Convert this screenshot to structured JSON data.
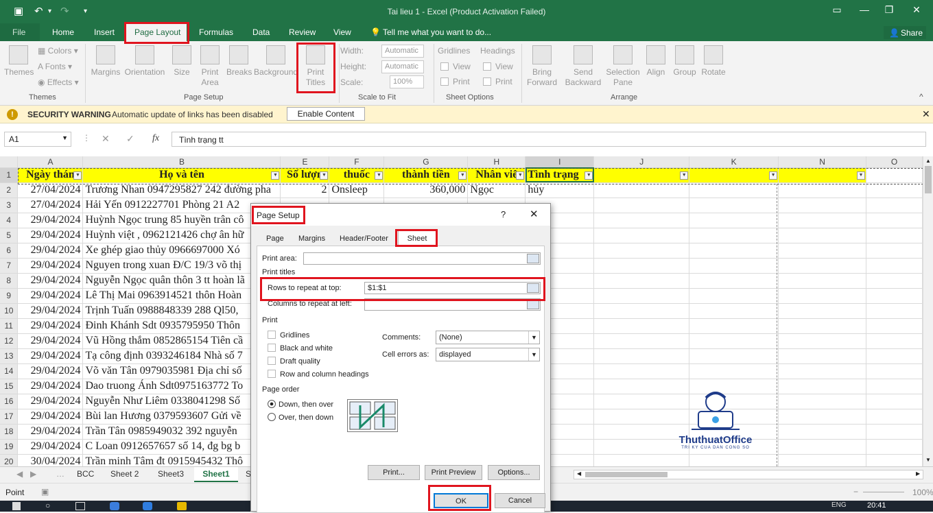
{
  "app": {
    "title": "Tai lieu 1 - Excel (Product Activation Failed)"
  },
  "tabs": [
    "File",
    "Home",
    "Insert",
    "Page Layout",
    "Formulas",
    "Data",
    "Review",
    "View"
  ],
  "tell_me": "Tell me what you want to do...",
  "share": "Share",
  "ribbon": {
    "themes": "Themes",
    "colors": "Colors",
    "fonts": "Fonts",
    "effects": "Effects",
    "margins": "Margins",
    "orientation": "Orientation",
    "size": "Size",
    "print_area": "Print Area",
    "breaks": "Breaks",
    "background": "Background",
    "print_titles": "Print Titles",
    "width": "Width:",
    "height": "Height:",
    "scale": "Scale:",
    "automatic": "Automatic",
    "scale_val": "100%",
    "gridlines": "Gridlines",
    "headings": "Headings",
    "view": "View",
    "print": "Print",
    "bring_forward": "Bring Forward",
    "send_backward": "Send Backward",
    "selection_pane": "Selection Pane",
    "align": "Align",
    "group": "Group",
    "rotate": "Rotate",
    "groups": {
      "themes": "Themes",
      "page_setup": "Page Setup",
      "scale_to_fit": "Scale to Fit",
      "sheet_options": "Sheet Options",
      "arrange": "Arrange"
    }
  },
  "security": {
    "title": "SECURITY WARNING",
    "message": "Automatic update of links has been disabled",
    "button": "Enable Content"
  },
  "formula_bar": {
    "name_box": "A1",
    "formula": "Tình trạng tt",
    "fx": "fx"
  },
  "grid": {
    "columns": [
      "A",
      "B",
      "E",
      "F",
      "G",
      "H",
      "I",
      "J",
      "K",
      "N",
      "O"
    ],
    "header_row": [
      "Ngày thán",
      "Họ và tên",
      "Số lượn",
      "thuốc",
      "thành tiền",
      "Nhân viê",
      "Tình trạng",
      "",
      "",
      "",
      ""
    ],
    "rows": [
      {
        "n": "2",
        "a": "27/04/2024",
        "b": "Trương Nhan 0947295827 242 đường pha",
        "e": "2",
        "f": "Onsleep",
        "g": "360,000",
        "h": "Ngọc",
        "i": "hủy"
      },
      {
        "n": "3",
        "a": "27/04/2024",
        "b": "Hải Yến 0912227701 Phòng 21 A2",
        "e": "",
        "f": "",
        "g": "",
        "h": "",
        "i": ""
      },
      {
        "n": "4",
        "a": "29/04/2024",
        "b": "Huỳnh Ngọc trung 85 huyền trân cô",
        "e": "",
        "f": "",
        "g": "",
        "h": "",
        "i": ""
      },
      {
        "n": "5",
        "a": "29/04/2024",
        "b": "Huỳnh việt , 0962121426 chợ ân hữ",
        "e": "",
        "f": "",
        "g": "",
        "h": "",
        "i": ""
      },
      {
        "n": "6",
        "a": "29/04/2024",
        "b": "Xe ghép giao thủy 0966697000 Xó",
        "e": "",
        "f": "",
        "g": "",
        "h": "",
        "i": ""
      },
      {
        "n": "7",
        "a": "29/04/2024",
        "b": "Nguyen trong xuan Đ/C 19/3 võ thị",
        "e": "",
        "f": "",
        "g": "",
        "h": "",
        "i": ""
      },
      {
        "n": "8",
        "a": "29/04/2024",
        "b": "Nguyễn Ngọc quân thôn 3 tt hoàn lã",
        "e": "",
        "f": "",
        "g": "",
        "h": "",
        "i": ""
      },
      {
        "n": "9",
        "a": "29/04/2024",
        "b": "Lê Thị Mai 0963914521 thôn Hoàn",
        "e": "",
        "f": "",
        "g": "",
        "h": "",
        "i": ""
      },
      {
        "n": "10",
        "a": "29/04/2024",
        "b": "Trịnh Tuấn 0988848339 288 Ql50,",
        "e": "",
        "f": "",
        "g": "",
        "h": "",
        "i": ""
      },
      {
        "n": "11",
        "a": "29/04/2024",
        "b": "Đinh Khánh Sdt 0935795950 Thôn",
        "e": "",
        "f": "",
        "g": "",
        "h": "",
        "i": ""
      },
      {
        "n": "12",
        "a": "29/04/2024",
        "b": "Vũ Hồng thắm 0852865154 Tiên cầ",
        "e": "",
        "f": "",
        "g": "",
        "h": "",
        "i": ""
      },
      {
        "n": "13",
        "a": "29/04/2024",
        "b": "Tạ công định 0393246184 Nhà số 7",
        "e": "",
        "f": "",
        "g": "",
        "h": "",
        "i": ""
      },
      {
        "n": "14",
        "a": "29/04/2024",
        "b": "Võ văn Tân 0979035981 Địa chỉ số",
        "e": "",
        "f": "",
        "g": "",
        "h": "",
        "i": ""
      },
      {
        "n": "15",
        "a": "29/04/2024",
        "b": "Dao truong Ánh Sdt0975163772 To",
        "e": "",
        "f": "",
        "g": "",
        "h": "",
        "i": ""
      },
      {
        "n": "16",
        "a": "29/04/2024",
        "b": "Nguyễn Như Liêm 0338041298 Số",
        "e": "",
        "f": "",
        "g": "",
        "h": "",
        "i": ""
      },
      {
        "n": "17",
        "a": "29/04/2024",
        "b": "Bùi lan Hương 0379593607 Gửi về",
        "e": "",
        "f": "",
        "g": "",
        "h": "",
        "i": ""
      },
      {
        "n": "18",
        "a": "29/04/2024",
        "b": "Trần Tân 0985949032 392 nguyễn",
        "e": "",
        "f": "",
        "g": "",
        "h": "",
        "i": ""
      },
      {
        "n": "19",
        "a": "29/04/2024",
        "b": "C Loan 0912657657 số 14, đg bg b",
        "e": "",
        "f": "",
        "g": "",
        "h": "",
        "i": ""
      },
      {
        "n": "20",
        "a": "30/04/2024",
        "b": "Trần minh Tâm đt 0915945432 Thô",
        "e": "",
        "f": "",
        "g": "",
        "h": "",
        "i": ""
      }
    ]
  },
  "sheet_tabs": [
    "BCC",
    "Sheet 2",
    "Sheet3",
    "Sheet1",
    "S"
  ],
  "status": {
    "mode": "Point",
    "zoom": "100%"
  },
  "taskbar": {
    "time": "20:41",
    "lang": "ENG"
  },
  "dialog": {
    "title": "Page Setup",
    "help": "?",
    "tabs": [
      "Page",
      "Margins",
      "Header/Footer",
      "Sheet"
    ],
    "print_area": "Print area:",
    "print_titles": "Print titles",
    "rows_repeat": "Rows to repeat at top:",
    "rows_repeat_value": "$1:$1",
    "cols_repeat": "Columns to repeat at left:",
    "print": "Print",
    "gridlines": "Gridlines",
    "black_white": "Black and white",
    "draft": "Draft quality",
    "row_col_headings": "Row and column headings",
    "comments_label": "Comments:",
    "comments_value": "(None)",
    "errors_label": "Cell errors as:",
    "errors_value": "displayed",
    "page_order": "Page order",
    "down_over": "Down, then over",
    "over_down": "Over, then down",
    "btn_print": "Print...",
    "btn_preview": "Print Preview",
    "btn_options": "Options...",
    "btn_ok": "OK",
    "btn_cancel": "Cancel"
  },
  "watermark": {
    "brand": "ThuthuatOffice",
    "tagline": "TRI KY CUA DAN CONG SO"
  }
}
